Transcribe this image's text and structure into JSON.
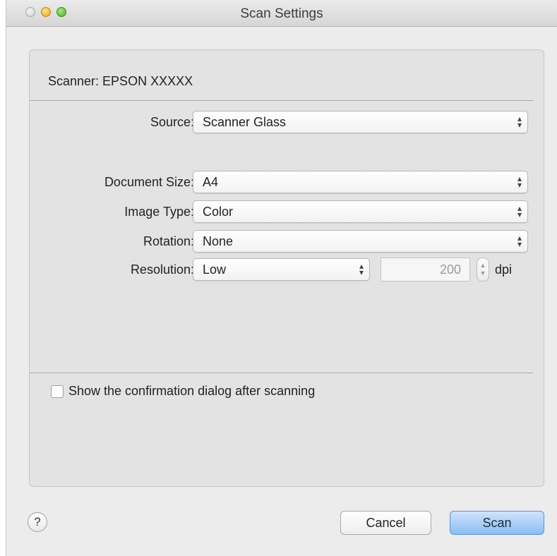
{
  "window": {
    "title": "Scan Settings"
  },
  "scanner": {
    "label": "Scanner: EPSON XXXXX"
  },
  "fields": {
    "source": {
      "label": "Source:",
      "value": "Scanner Glass"
    },
    "document_size": {
      "label": "Document Size:",
      "value": "A4"
    },
    "image_type": {
      "label": "Image Type:",
      "value": "Color"
    },
    "rotation": {
      "label": "Rotation:",
      "value": "None"
    },
    "resolution": {
      "label": "Resolution:",
      "value": "Low",
      "dpi_value": "200",
      "unit": "dpi"
    }
  },
  "options": {
    "confirm_dialog": {
      "label": "Show the confirmation dialog after scanning",
      "checked": false
    }
  },
  "footer": {
    "help_label": "?",
    "cancel_label": "Cancel",
    "scan_label": "Scan"
  },
  "icons": {
    "popup_arrows": "⬍",
    "stepper_up": "▲",
    "stepper_down": "▼"
  }
}
